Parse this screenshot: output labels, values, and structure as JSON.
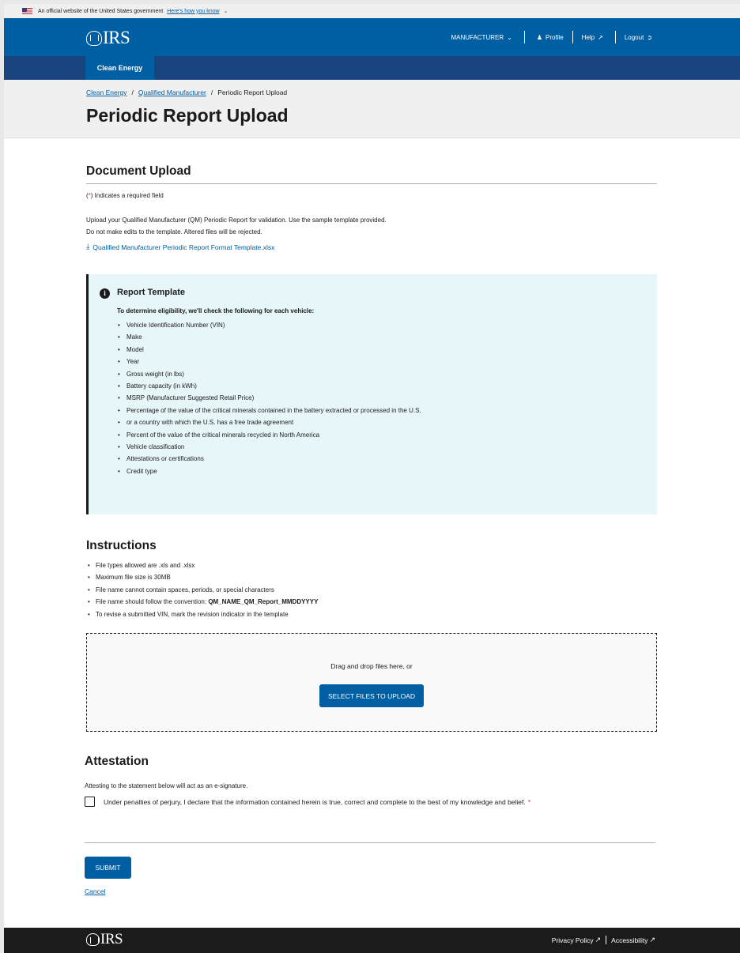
{
  "gov_banner": {
    "text": "An official website of the United States government",
    "link": "Here's how you know",
    "caret": "⌄"
  },
  "header": {
    "logo": "IRS",
    "nav": {
      "manufacturer": "MANUFACTURER",
      "manufacturer_caret": "⌄",
      "profile": "Profile",
      "help": "Help",
      "logout": "Logout"
    },
    "tab": "Clean Energy"
  },
  "breadcrumb": {
    "items": [
      "Clean Energy",
      "Qualified Manufacturer",
      "Periodic Report Upload"
    ],
    "separator": "/"
  },
  "page_title": "Periodic Report Upload",
  "document_upload": {
    "title": "Document Upload",
    "required_star": "*",
    "required_note": ") Indicates a required field",
    "required_open": "(",
    "intro_line1": "Upload your Qualified Manufacturer (QM) Periodic Report for validation. Use the sample template provided.",
    "intro_line2": "Do not make edits to the template. Altered files will be rejected.",
    "template_link": "Qualified Manufacturer Periodic Report Format Template.xlsx"
  },
  "report_template": {
    "icon": "i",
    "title": "Report Template",
    "lead": "To determine eligibility, we'll check the following for each vehicle:",
    "items": [
      "Vehicle Identification Number (VIN)",
      "Make",
      "Model",
      "Year",
      "Gross weight (in lbs)",
      "Battery capacity (in kWh)",
      "MSRP (Manufacturer Suggested Retail Price)",
      "Percentage of the value of the critical minerals contained in the battery extracted or processed in the U.S.",
      "or a country with which the U.S. has a free trade agreement",
      "Percent of the value of the critical minerals recycled in North America",
      "Vehicle classification",
      "Attestations or certifications",
      "Credit type"
    ]
  },
  "instructions": {
    "title": "Instructions",
    "items": [
      "File types allowed are .xls and .xlsx",
      "Maximum file size is 30MB",
      "File name cannot contain spaces, periods, or special characters",
      "File name should follow the convention: ",
      "To revise a submitted VIN, mark the revision indicator in the template"
    ],
    "convention": "QM_NAME_QM_Report_MMDDYYYY"
  },
  "dropzone": {
    "text": "Drag and drop files here, or",
    "button": "SELECT FILES TO UPLOAD"
  },
  "attestation": {
    "title": "Attestation",
    "note": "Attesting to the statement below will act as an e-signature.",
    "statement": "Under penalties of perjury, I declare that the information contained herein is true, correct and complete to the best of my knowledge and belief.",
    "required_star": "*",
    "checked": false
  },
  "actions": {
    "submit": "SUBMIT",
    "cancel": "Cancel"
  },
  "footer": {
    "logo": "IRS",
    "privacy": "Privacy Policy",
    "accessibility": "Accessibility"
  },
  "colors": {
    "primary": "#005ea2",
    "subnav": "#1a4480",
    "alert_bg": "#e7f6f8",
    "required": "#d83933",
    "footer": "#1b1b1b"
  }
}
